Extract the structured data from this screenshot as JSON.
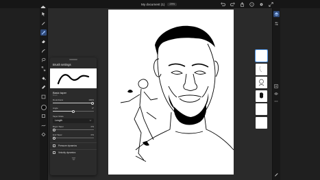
{
  "header": {
    "document_title": "My document (1)",
    "zoom": "29%"
  },
  "colors": {
    "app_background": "#1f1f1f",
    "accent": "#4a90e2",
    "current_color": "#0a0a0a"
  },
  "toolbar_left": {
    "tools": [
      "home-icon",
      "brush-icon",
      "pencil-icon",
      "active-brush-icon",
      "eraser-icon",
      "smudge-icon",
      "lasso-icon",
      "fill-icon",
      "eyedropper-icon",
      "shape-icon",
      "transform-icon"
    ]
  },
  "brush_settings": {
    "title": "Brush settings",
    "brush_name": "Basic taper",
    "brush_sub": "Brush",
    "roundness_label": "Roundness",
    "roundness_value": "100%",
    "roundness_level": 1.0,
    "angle_label": "Angle",
    "angle_value": "0°",
    "angle_level": 0.5,
    "taper_mode_label": "Taper Mode",
    "taper_mode_value": "Length",
    "begin_taper_label": "Begin Taper",
    "begin_taper_value": "0%",
    "end_taper_label": "End Taper",
    "end_taper_value": "0%",
    "pressure_label": "Pressure dynamics",
    "velocity_label": "Velocity dynamics"
  },
  "layers": {
    "count": 6,
    "selected_index": 0
  }
}
